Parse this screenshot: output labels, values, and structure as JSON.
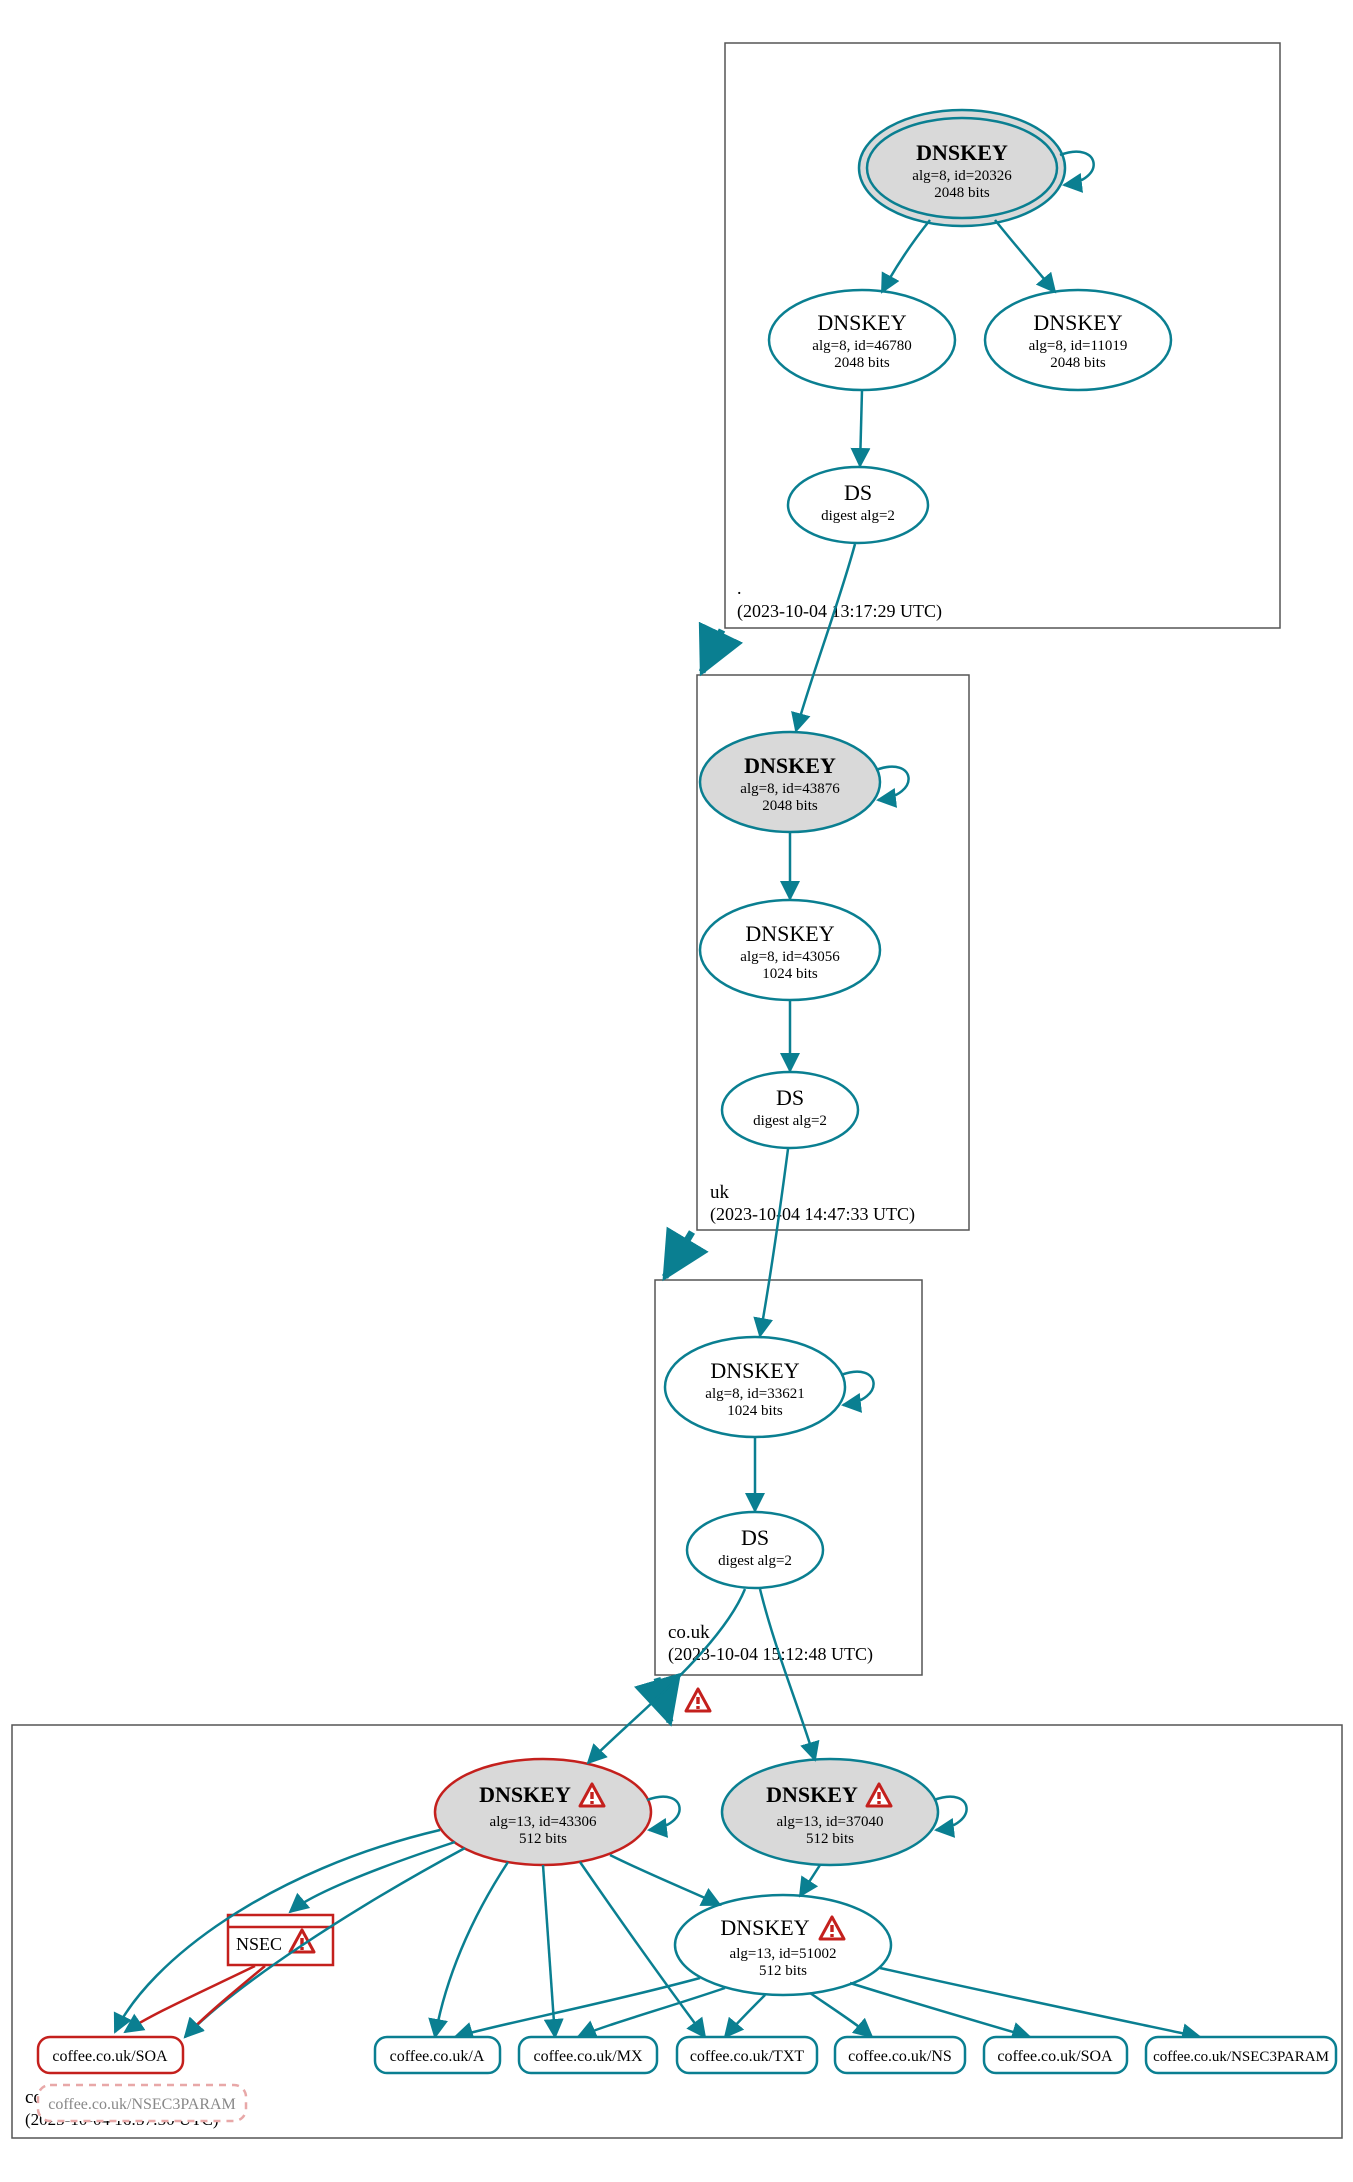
{
  "zones": {
    "root": {
      "label": ".",
      "timestamp": "(2023-10-04 13:17:29 UTC)"
    },
    "uk": {
      "label": "uk",
      "timestamp": "(2023-10-04 14:47:33 UTC)"
    },
    "couk": {
      "label": "co.uk",
      "timestamp": "(2023-10-04 15:12:48 UTC)"
    },
    "coffee": {
      "label": "coffee.co.uk",
      "timestamp": "(2023-10-04 16:57:30 UTC)"
    }
  },
  "nodes": {
    "root_ksk": {
      "title": "DNSKEY",
      "l2": "alg=8, id=20326",
      "l3": "2048 bits"
    },
    "root_zsk1": {
      "title": "DNSKEY",
      "l2": "alg=8, id=46780",
      "l3": "2048 bits"
    },
    "root_zsk2": {
      "title": "DNSKEY",
      "l2": "alg=8, id=11019",
      "l3": "2048 bits"
    },
    "root_ds": {
      "title": "DS",
      "l2": "digest alg=2"
    },
    "uk_ksk": {
      "title": "DNSKEY",
      "l2": "alg=8, id=43876",
      "l3": "2048 bits"
    },
    "uk_zsk": {
      "title": "DNSKEY",
      "l2": "alg=8, id=43056",
      "l3": "1024 bits"
    },
    "uk_ds": {
      "title": "DS",
      "l2": "digest alg=2"
    },
    "couk_ksk": {
      "title": "DNSKEY",
      "l2": "alg=8, id=33621",
      "l3": "1024 bits"
    },
    "couk_ds": {
      "title": "DS",
      "l2": "digest alg=2"
    },
    "coffee_k1": {
      "title": "DNSKEY",
      "l2": "alg=13, id=43306",
      "l3": "512 bits"
    },
    "coffee_k2": {
      "title": "DNSKEY",
      "l2": "alg=13, id=37040",
      "l3": "512 bits"
    },
    "coffee_k3": {
      "title": "DNSKEY",
      "l2": "alg=13, id=51002",
      "l3": "512 bits"
    },
    "nsec": {
      "title": "NSEC"
    }
  },
  "records": {
    "r_soa_red": "coffee.co.uk/SOA",
    "r_nsec3_red": "coffee.co.uk/NSEC3PARAM",
    "r_a": "coffee.co.uk/A",
    "r_mx": "coffee.co.uk/MX",
    "r_txt": "coffee.co.uk/TXT",
    "r_ns": "coffee.co.uk/NS",
    "r_soa": "coffee.co.uk/SOA",
    "r_nsec3": "coffee.co.uk/NSEC3PARAM"
  },
  "colors": {
    "teal": "#0a7f91",
    "red": "#c4201d",
    "pink": "#e8a8a8",
    "grayFill": "#d9d9d9",
    "boxStroke": "#555"
  }
}
